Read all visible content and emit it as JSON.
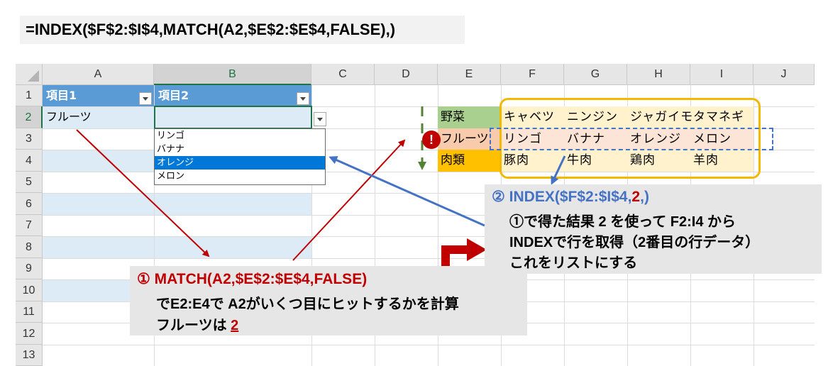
{
  "formula": "=INDEX($F$2:$I$4,MATCH(A2,$E$2:$E$4,FALSE),)",
  "columns": [
    "A",
    "B",
    "C",
    "D",
    "E",
    "F",
    "G",
    "H",
    "I",
    "J"
  ],
  "rows": [
    "1",
    "2",
    "3",
    "4",
    "5",
    "6",
    "7",
    "8",
    "9",
    "10",
    "11",
    "12",
    "13"
  ],
  "table": {
    "header_a": "項目1",
    "header_b": "項目2",
    "a2": "フルーツ"
  },
  "dropdown": {
    "options": [
      "リンゴ",
      "バナナ",
      "オレンジ",
      "メロン"
    ],
    "selected_index": 2
  },
  "master": {
    "categories": [
      "野菜",
      "フルーツ",
      "肉類"
    ],
    "items": [
      [
        "キャベツ",
        "ニンジン",
        "ジャガイモ",
        "タマネギ"
      ],
      [
        "リンゴ",
        "バナナ",
        "オレンジ",
        "メロン"
      ],
      [
        "豚肉",
        "牛肉",
        "鶏肉",
        "羊肉"
      ]
    ]
  },
  "colors": {
    "veg": "#a9d08e",
    "fruit": "#f8cbad",
    "meat": "#ffc000",
    "table_header": "#5b9bd5",
    "band": "#ddebf7",
    "accent_red": "#c00000",
    "accent_blue": "#4472c4",
    "highlight_yellow": "#fff2cc",
    "highlight_orange": "#fce4d6"
  },
  "callout_match": {
    "title_num": "①",
    "title_formula": "MATCH(A2,$E$2:$E$4,FALSE)",
    "line1": "でE2:E4で A2がいくつ目にヒットするかを計算",
    "line2_prefix": "フルーツは ",
    "line2_value": "2"
  },
  "callout_index": {
    "title_num": "②",
    "title_part1": "INDEX($F$2:$I$4,",
    "title_part2": "2",
    "title_part3": ",)",
    "line1": "①で得た結果 2 を使って F2:I4 から",
    "line2": "INDEXで行を取得（2番目の行データ）",
    "line3": "これをリストにする"
  },
  "warning_symbol": "!"
}
